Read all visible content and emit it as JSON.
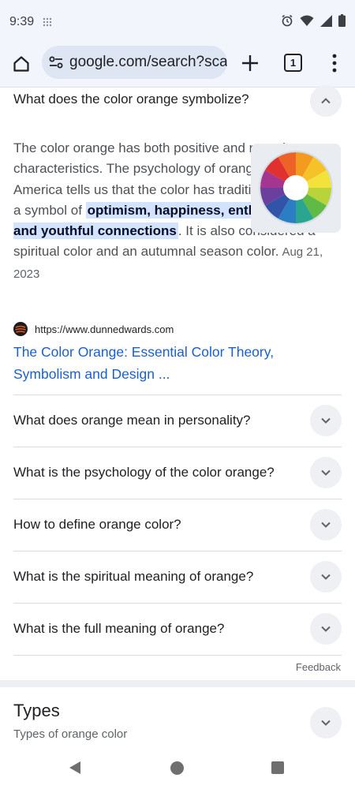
{
  "status_bar": {
    "time": "9:39",
    "icons": [
      "grid-icon",
      "alarm-icon",
      "wifi-icon",
      "signal-icon",
      "battery-icon"
    ]
  },
  "toolbar": {
    "url": "google.com/search?sca_",
    "tab_count": "1",
    "icons": [
      "home-icon",
      "site-settings-icon",
      "new-tab-icon",
      "tab-switcher-icon",
      "more-menu-icon"
    ]
  },
  "expanded_question": {
    "question": "What does the color orange symbolize?",
    "answer_before": "The color orange has both positive and negative characteristics. The psychology of orange in North America tells us that the color has traditionally been a symbol of ",
    "answer_highlight": "optimism, happiness, enthusiasm and youthful connections",
    "answer_after": ". It is also considered a spiritual color and an autumnal season color.",
    "date": "Aug 21, 2023",
    "source_url": "https://www.dunnedwards.com",
    "source_title": "The Color Orange: Essential Color Theory, Symbolism and Design ..."
  },
  "questions": [
    "What does orange mean in personality?",
    "What is the psychology of the color orange?",
    "How to define orange color?",
    "What is the spiritual meaning of orange?",
    "What is the full meaning of orange?"
  ],
  "feedback_label": "Feedback",
  "types_section": {
    "title": "Types",
    "subtitle": "Types of orange color"
  },
  "colors": {
    "link": "#1a5fd0",
    "highlight": "#d3e3fd",
    "chrome_bg": "#f2f5fb",
    "url_bar_bg": "#dfe6f3"
  }
}
